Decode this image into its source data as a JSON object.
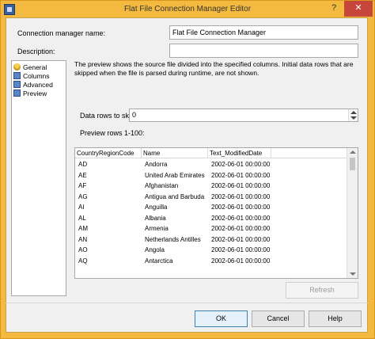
{
  "window": {
    "title": "Flat File Connection Manager Editor",
    "help_glyph": "?",
    "close_glyph": "✕"
  },
  "form": {
    "connection_manager_name_label": "Connection manager name:",
    "connection_manager_name_value": "Flat File Connection Manager",
    "description_label": "Description:",
    "description_value": ""
  },
  "nav": {
    "items": [
      {
        "label": "General",
        "icon": "general-icon",
        "selected": false
      },
      {
        "label": "Columns",
        "icon": "grid-icon",
        "selected": false
      },
      {
        "label": "Advanced",
        "icon": "grid-icon",
        "selected": false
      },
      {
        "label": "Preview",
        "icon": "grid-icon",
        "selected": true
      }
    ]
  },
  "preview": {
    "description": "The preview shows the source file divided into the specified columns. Initial data rows that are skipped when the file is parsed during runtime, are not shown.",
    "rows_to_skip_label": "Data rows to skip:",
    "rows_to_skip_value": "0",
    "preview_rows_label": "Preview rows 1-100:",
    "columns": [
      "CountryRegionCode",
      "Name",
      "Text_ModifiedDate"
    ],
    "rows": [
      [
        "AD",
        "Andorra",
        "2002-06-01 00:00:00"
      ],
      [
        "AE",
        "United Arab Emirates",
        "2002-06-01 00:00:00"
      ],
      [
        "AF",
        "Afghanistan",
        "2002-06-01 00:00:00"
      ],
      [
        "AG",
        "Antigua and Barbuda",
        "2002-06-01 00:00:00"
      ],
      [
        "AI",
        "Anguilla",
        "2002-06-01 00:00:00"
      ],
      [
        "AL",
        "Albania",
        "2002-06-01 00:00:00"
      ],
      [
        "AM",
        "Armenia",
        "2002-06-01 00:00:00"
      ],
      [
        "AN",
        "Netherlands Antilles",
        "2002-06-01 00:00:00"
      ],
      [
        "AO",
        "Angola",
        "2002-06-01 00:00:00"
      ],
      [
        "AQ",
        "Antarctica",
        "2002-06-01 00:00:00"
      ]
    ],
    "refresh_label": "Refresh"
  },
  "buttons": {
    "ok": "OK",
    "cancel": "Cancel",
    "help": "Help"
  }
}
